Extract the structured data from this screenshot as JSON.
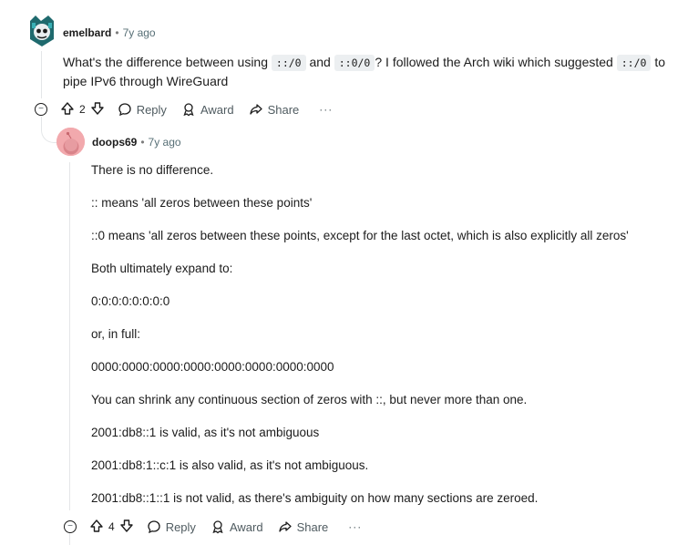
{
  "comment1": {
    "author": "emelbard",
    "separator": "•",
    "time": "7y ago",
    "text_1": "What's the difference between using",
    "code_1": "::/0",
    "text_2": "and",
    "code_2": "::0/0",
    "text_3": "? I followed the Arch wiki which suggested",
    "code_3": "::/0",
    "text_4": "to",
    "line2": "pipe IPv6 through WireGuard",
    "votes": "2",
    "reply_label": "Reply",
    "award_label": "Award",
    "share_label": "Share",
    "more_label": "···"
  },
  "comment2": {
    "author": "doops69",
    "separator": "•",
    "time": "7y ago",
    "paragraphs": [
      "There is no difference.",
      ":: means 'all zeros between these points'",
      "::0 means 'all zeros between these points, except for the last octet, which is also explicitly all zeros'",
      "Both ultimately expand to:",
      "0:0:0:0:0:0:0:0",
      "or, in full:",
      "0000:0000:0000:0000:0000:0000:0000:0000",
      "You can shrink any continuous section of zeros with ::, but never more than one.",
      "2001:db8::1 is valid, as it's not ambiguous",
      "2001:db8:1::c:1 is also valid, as it's not ambiguous.",
      "2001:db8::1::1 is not valid, as there's ambiguity on how many sections are zeroed."
    ],
    "votes": "4",
    "reply_label": "Reply",
    "award_label": "Award",
    "share_label": "Share",
    "more_label": "···"
  },
  "icons": [
    "avatar-snoo",
    "avatar-pink",
    "upvote-icon",
    "downvote-icon",
    "reply-bubble-icon",
    "award-icon",
    "share-icon",
    "collapse-icon",
    "more-icon"
  ],
  "colors": {
    "avatar_pink": "#f2a9ad",
    "meta_gray": "#576f76",
    "code_bg": "#eceff1"
  }
}
